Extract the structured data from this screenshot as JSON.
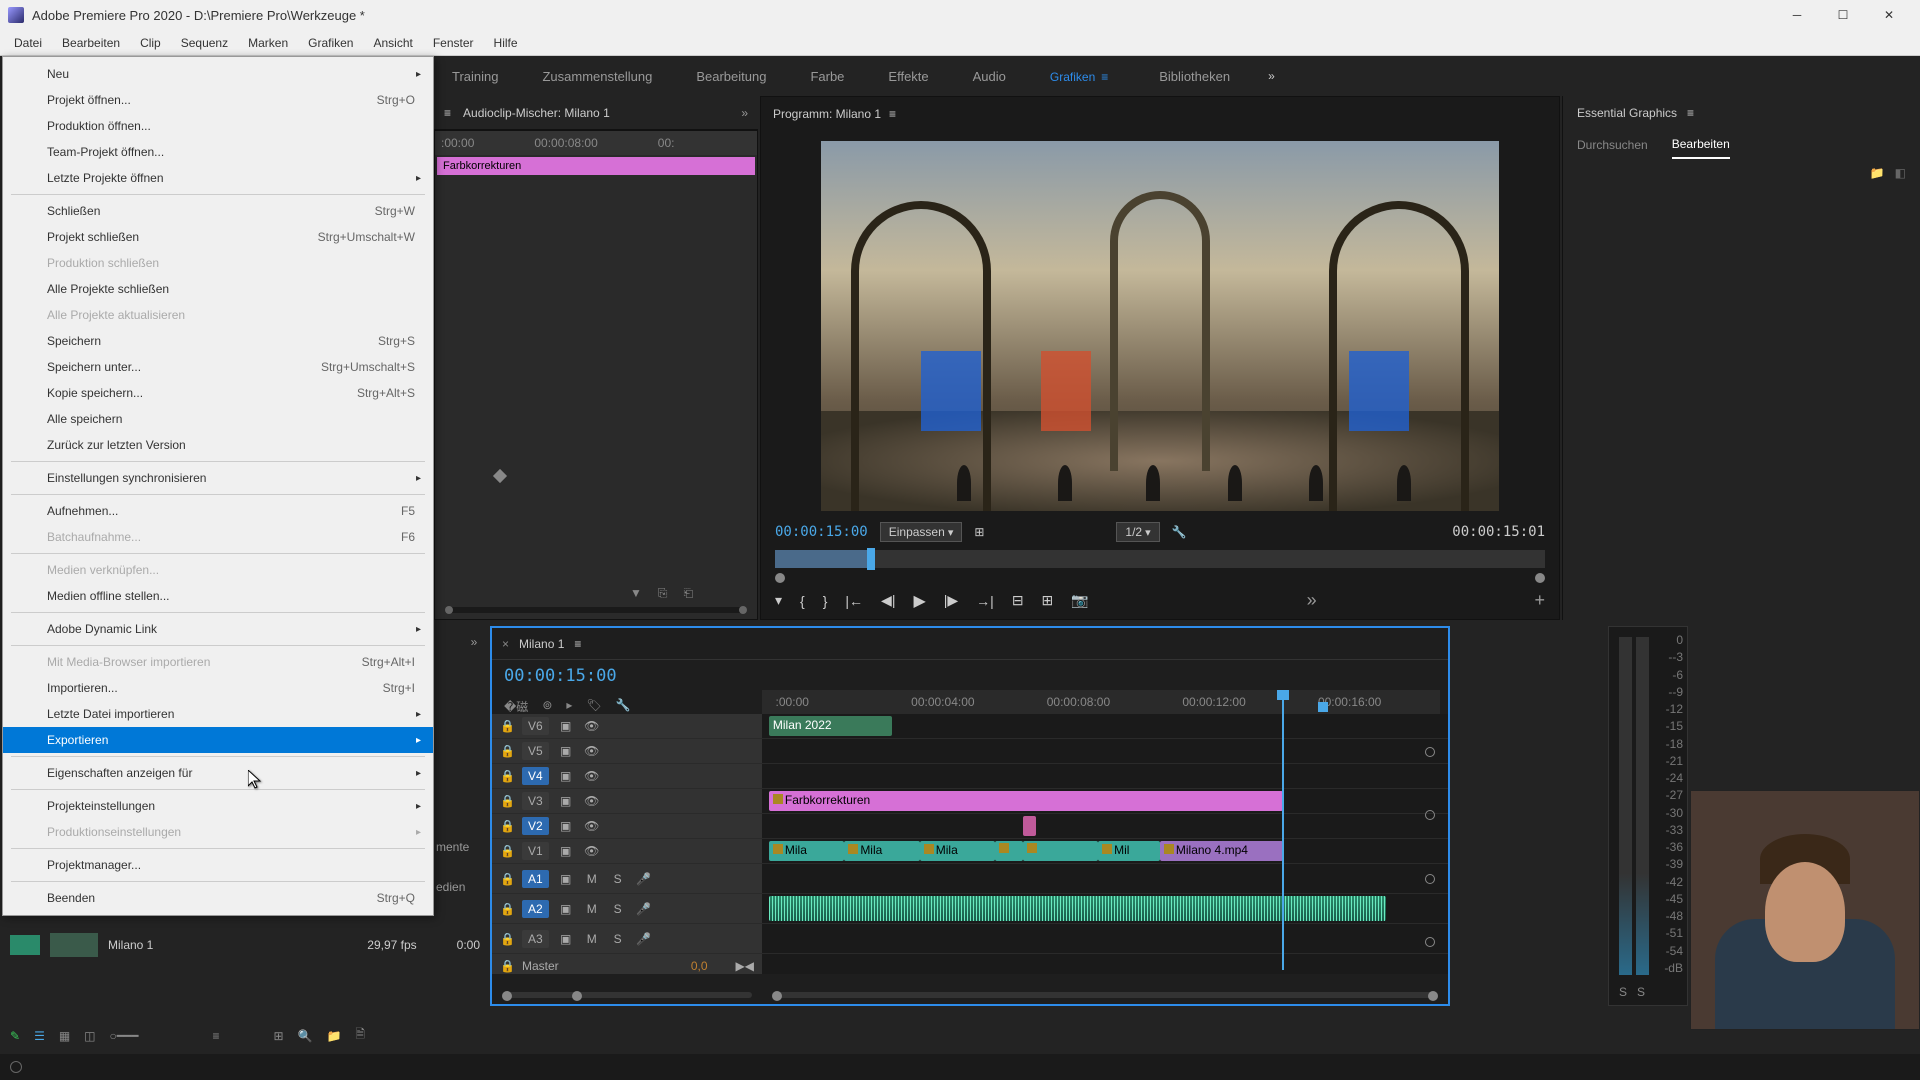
{
  "app": {
    "title": "Adobe Premiere Pro 2020 - D:\\Premiere Pro\\Werkzeuge *"
  },
  "menubar": [
    "Datei",
    "Bearbeiten",
    "Clip",
    "Sequenz",
    "Marken",
    "Grafiken",
    "Ansicht",
    "Fenster",
    "Hilfe"
  ],
  "workspaces": {
    "tabs": [
      "Training",
      "Zusammenstellung",
      "Bearbeitung",
      "Farbe",
      "Effekte",
      "Audio",
      "Grafiken",
      "Bibliotheken"
    ],
    "active": "Grafiken",
    "overflow": "»"
  },
  "dropdown": {
    "items": [
      {
        "label": "Neu",
        "sub": true
      },
      {
        "label": "Projekt öffnen...",
        "shortcut": "Strg+O"
      },
      {
        "label": "Produktion öffnen..."
      },
      {
        "label": "Team-Projekt öffnen..."
      },
      {
        "label": "Letzte Projekte öffnen",
        "sub": true
      },
      {
        "sep": true
      },
      {
        "label": "Schließen",
        "shortcut": "Strg+W"
      },
      {
        "label": "Projekt schließen",
        "shortcut": "Strg+Umschalt+W"
      },
      {
        "label": "Produktion schließen",
        "disabled": true
      },
      {
        "label": "Alle Projekte schließen"
      },
      {
        "label": "Alle Projekte aktualisieren",
        "disabled": true
      },
      {
        "label": "Speichern",
        "shortcut": "Strg+S"
      },
      {
        "label": "Speichern unter...",
        "shortcut": "Strg+Umschalt+S"
      },
      {
        "label": "Kopie speichern...",
        "shortcut": "Strg+Alt+S"
      },
      {
        "label": "Alle speichern"
      },
      {
        "label": "Zurück zur letzten Version"
      },
      {
        "sep": true
      },
      {
        "label": "Einstellungen synchronisieren",
        "sub": true
      },
      {
        "sep": true
      },
      {
        "label": "Aufnehmen...",
        "shortcut": "F5"
      },
      {
        "label": "Batchaufnahme...",
        "shortcut": "F6",
        "disabled": true
      },
      {
        "sep": true
      },
      {
        "label": "Medien verknüpfen...",
        "disabled": true
      },
      {
        "label": "Medien offline stellen..."
      },
      {
        "sep": true
      },
      {
        "label": "Adobe Dynamic Link",
        "sub": true
      },
      {
        "sep": true
      },
      {
        "label": "Mit Media-Browser importieren",
        "shortcut": "Strg+Alt+I",
        "disabled": true
      },
      {
        "label": "Importieren...",
        "shortcut": "Strg+I"
      },
      {
        "label": "Letzte Datei importieren",
        "sub": true
      },
      {
        "label": "Exportieren",
        "sub": true,
        "highlighted": true
      },
      {
        "sep": true
      },
      {
        "label": "Eigenschaften anzeigen für",
        "sub": true
      },
      {
        "sep": true
      },
      {
        "label": "Projekteinstellungen",
        "sub": true
      },
      {
        "label": "Produktionseinstellungen",
        "disabled": true,
        "sub": true
      },
      {
        "sep": true
      },
      {
        "label": "Projektmanager..."
      },
      {
        "sep": true
      },
      {
        "label": "Beenden",
        "shortcut": "Strg+Q"
      }
    ]
  },
  "audio_mixer": {
    "title": "Audioclip-Mischer: Milano 1",
    "expand": "»"
  },
  "effects_strip": {
    "ruler": [
      ":00:00",
      "00:00:08:00",
      "00:"
    ],
    "effect": "Farbkorrekturen"
  },
  "program": {
    "title": "Programm: Milano 1",
    "timecode_left": "00:00:15:00",
    "fit": "Einpassen",
    "scale": "1/2",
    "timecode_right": "00:00:15:01"
  },
  "essential_graphics": {
    "title": "Essential Graphics",
    "tabs": [
      "Durchsuchen",
      "Bearbeiten"
    ],
    "active": "Bearbeiten"
  },
  "timeline": {
    "name": "Milano 1",
    "timecode": "00:00:15:00",
    "ruler": [
      ":00:00",
      "00:00:04:00",
      "00:00:08:00",
      "00:00:12:00",
      "00:00:16:00"
    ],
    "tracks": {
      "v6": "V6",
      "v5": "V5",
      "v4": "V4",
      "v3": "V3",
      "v2": "V2",
      "v1": "V1",
      "a1": "A1",
      "a2": "A2",
      "a3": "A3",
      "master": "Master",
      "master_val": "0,0"
    },
    "clips": {
      "title": "Milan 2022",
      "adjust": "Farbkorrekturen",
      "c1": "Mila",
      "c2": "Mila",
      "c3": "Mila",
      "c4": "Mil",
      "c5": "Milano 4.mp4"
    },
    "toggles": {
      "m": "M",
      "s": "S"
    }
  },
  "project_item": {
    "name": "Milano 1",
    "fps": "29,97 fps",
    "dur": "0:00"
  },
  "meter": {
    "scale": [
      "0",
      "--3",
      "-6",
      "--9",
      "-12",
      "-15",
      "-18",
      "-21",
      "-24",
      "-27",
      "-30",
      "-33",
      "-36",
      "-39",
      "-42",
      "-45",
      "-48",
      "-51",
      "-54",
      "-dB"
    ],
    "s": "S"
  },
  "fragments": {
    "mente": "mente",
    "edien": "edien"
  }
}
